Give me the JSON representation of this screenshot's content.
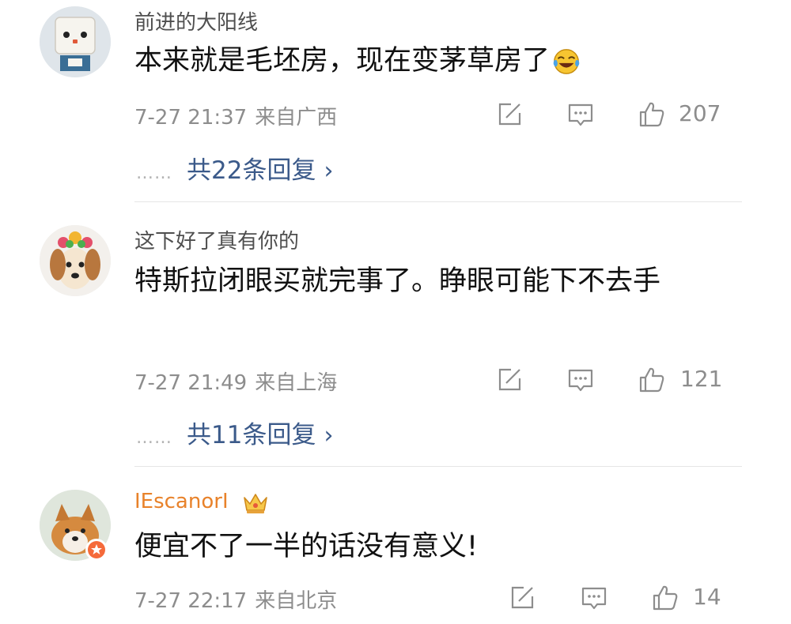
{
  "comments": [
    {
      "username": "前进的大阳线",
      "content": "本来就是毛坯房，现在变茅草房了",
      "emoji": "laugh-cry-emoji",
      "date": "7-27 21:37",
      "location": "来自广西",
      "likes": "207",
      "replies_label": "共22条回复",
      "dots": "……",
      "chevron": "›"
    },
    {
      "username": "这下好了真有你的",
      "content": "特斯拉闭眼买就完事了。睁眼可能下不去手",
      "date": "7-27 21:49",
      "location": "来自上海",
      "likes": "121",
      "replies_label": "共11条回复",
      "dots": "……",
      "chevron": "›"
    },
    {
      "username": "IEscanorI",
      "content": "便宜不了一半的话没有意义!",
      "date": "7-27 22:17",
      "location": "来自北京",
      "likes": "14",
      "vip": true
    }
  ],
  "colors": {
    "link": "#3b5a8a",
    "meta": "#8d8d8d",
    "vip_name": "#e8822a"
  },
  "icons": [
    "edit-icon",
    "comment-icon",
    "thumbs-up-icon",
    "crown-icon",
    "badge-icon"
  ]
}
